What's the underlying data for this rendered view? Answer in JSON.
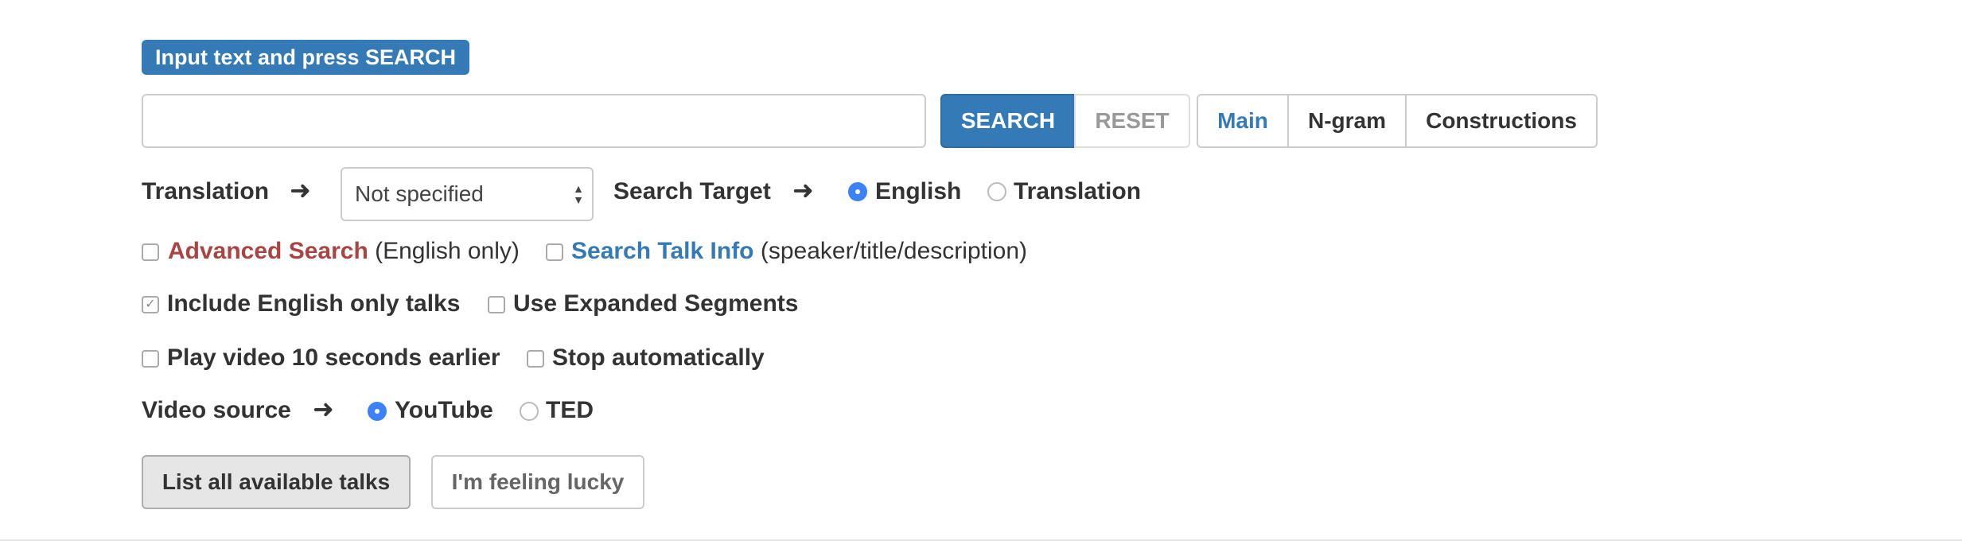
{
  "header": {
    "badge": "Input text and press SEARCH"
  },
  "search": {
    "value": "",
    "placeholder": "",
    "search_label": "SEARCH",
    "reset_label": "RESET"
  },
  "tabs": [
    {
      "label": "Main",
      "active": true
    },
    {
      "label": "N-gram",
      "active": false
    },
    {
      "label": "Constructions",
      "active": false
    }
  ],
  "translation": {
    "label": "Translation",
    "selected": "Not specified"
  },
  "search_target": {
    "label": "Search Target",
    "options": [
      {
        "label": "English",
        "checked": true
      },
      {
        "label": "Translation",
        "checked": false
      }
    ]
  },
  "options": {
    "advanced_search": {
      "label": "Advanced Search",
      "note": "(English only)",
      "checked": false
    },
    "search_talk_info": {
      "label": "Search Talk Info",
      "note": "(speaker/title/description)",
      "checked": false
    },
    "include_english_only": {
      "label": "Include English only talks",
      "checked": true
    },
    "use_expanded_segments": {
      "label": "Use Expanded Segments",
      "checked": false
    },
    "play_earlier": {
      "label": "Play video 10 seconds earlier",
      "checked": false
    },
    "stop_automatically": {
      "label": "Stop automatically",
      "checked": false
    }
  },
  "video_source": {
    "label": "Video source",
    "options": [
      {
        "label": "YouTube",
        "checked": true
      },
      {
        "label": "TED",
        "checked": false
      }
    ]
  },
  "actions": {
    "list_all": "List all available talks",
    "lucky": "I'm feeling lucky"
  },
  "colors": {
    "primary": "#337ab7",
    "danger_link": "#a94442",
    "radio_on": "#3b82f6"
  }
}
